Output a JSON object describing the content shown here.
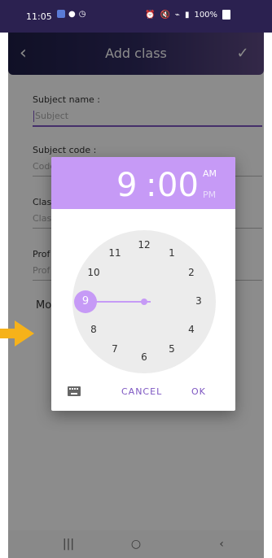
{
  "status": {
    "time": "11:05",
    "battery": "100%"
  },
  "appbar": {
    "title": "Add class"
  },
  "form": {
    "subject_label": "Subject name :",
    "subject_placeholder": "Subject",
    "code_label": "Subject code :",
    "code_placeholder": "Code",
    "class_label": "Clas",
    "class_placeholder": "Clas",
    "prof_label": "Prof",
    "prof_placeholder": "Prof",
    "more_label": "Mo"
  },
  "dialog": {
    "hour": "9",
    "colon": ":",
    "minute": "00",
    "am": "AM",
    "pm": "PM",
    "clock_numbers": [
      "12",
      "1",
      "2",
      "3",
      "4",
      "5",
      "6",
      "7",
      "8",
      "9",
      "10",
      "11"
    ],
    "selected_hour": "9",
    "cancel": "CANCEL",
    "ok": "OK"
  },
  "colors": {
    "accent": "#c69af6",
    "primary_text": "#7e57c2",
    "appbar_left": "#1e1e46",
    "appbar_right": "#5f4a84"
  }
}
